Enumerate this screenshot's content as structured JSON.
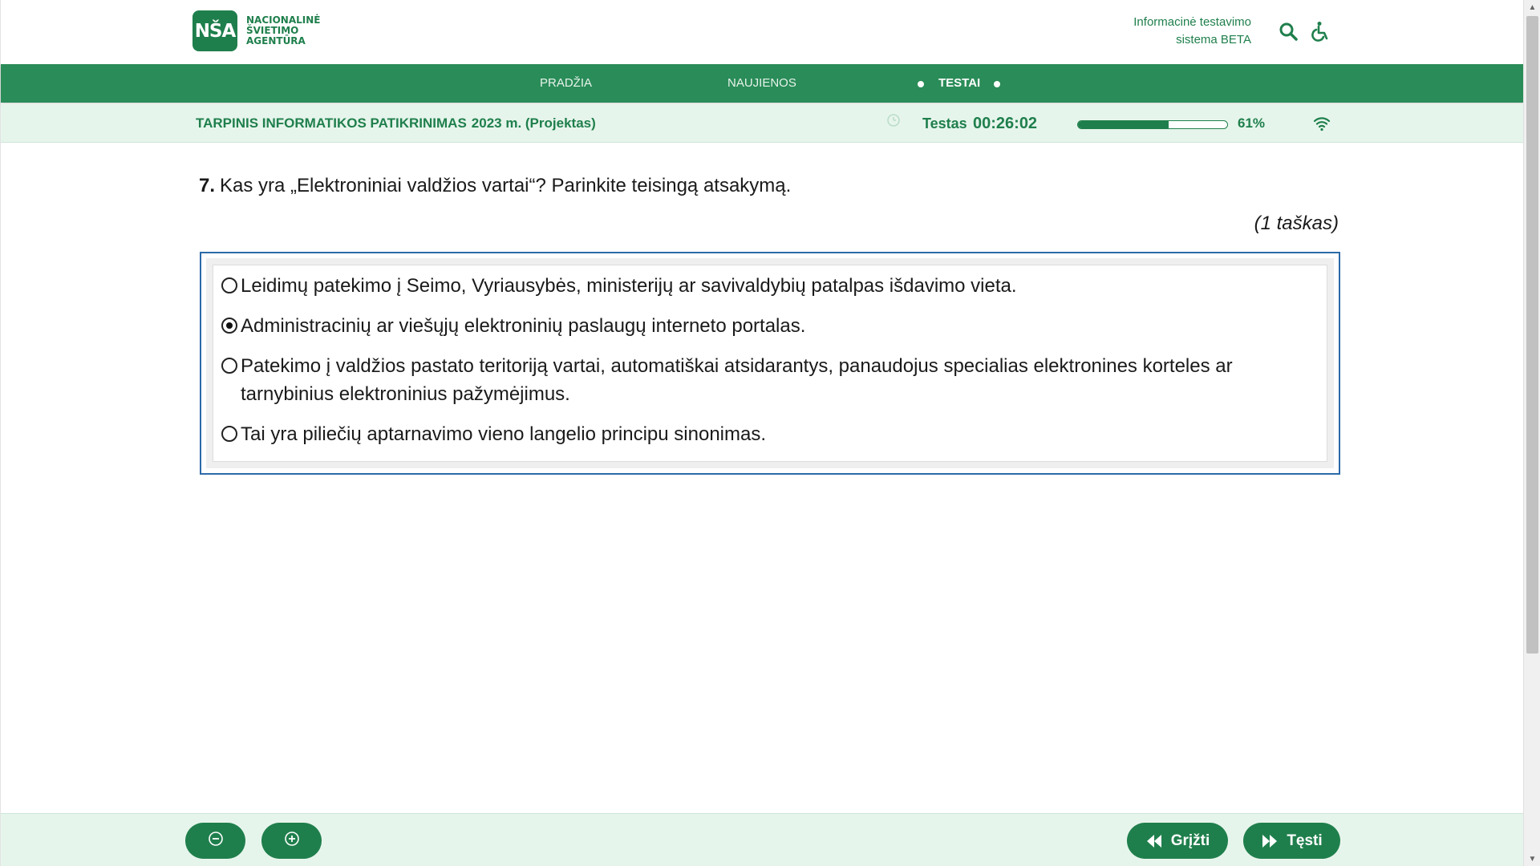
{
  "header": {
    "logo_mark": "NŠA",
    "logo_lines": [
      "NACIONALINĖ",
      "ŠVIETIMO",
      "AGENTŪRA"
    ],
    "system_title_line1": "Informacinė testavimo",
    "system_title_line2": "sistema BETA",
    "icons": [
      "search-icon",
      "accessibility-icon"
    ]
  },
  "nav": {
    "items": [
      {
        "label": "PRADŽIA"
      },
      {
        "label": "NAUJIENOS"
      },
      {
        "label": "TESTAI"
      }
    ],
    "active": "TESTAI"
  },
  "testbar": {
    "title": "TARPINIS INFORMATIKOS PATIKRINIMAS",
    "year": "2023 m. (Projektas)",
    "timer_label": "Testas",
    "timer": "00:26:02",
    "progress": 0.61,
    "progress_label": "61%",
    "icons": [
      "clock-icon",
      "wifi-icon"
    ]
  },
  "question": {
    "number": "7.",
    "text": "Kas yra „Elektroniniai valdžios vartai“? Parinkite teisingą atsakymą.",
    "points": "(1 taškas)",
    "options": [
      {
        "text": "Leidimų patekimo į Seimo, Vyriausybės, ministerijų ar savivaldybių patalpas išdavimo vieta.",
        "selected": false
      },
      {
        "text": "Administracinių ar viešųjų elektroninių paslaugų interneto portalas.",
        "selected": true
      },
      {
        "text": "Patekimo į valdžios pastato teritoriją vartai, automatiškai atsidarantys, panaudojus specialias elektronines korteles ar tarnybinius elektroninius pažymėjimus.",
        "selected": false
      },
      {
        "text": "Tai yra piliečių aptarnavimo vieno langelio principu sinonimas.",
        "selected": false
      }
    ]
  },
  "footer": {
    "zoom_out_icon": "zoom-out-icon",
    "zoom_in_icon": "zoom-in-icon",
    "back_label": "Grįžti",
    "next_label": "Tęsti"
  },
  "colors": {
    "brand_green": "#1f7f4c",
    "nav_green": "#2a8c58",
    "light_green": "#e6f5ec",
    "option_border": "#2c6aa8"
  }
}
